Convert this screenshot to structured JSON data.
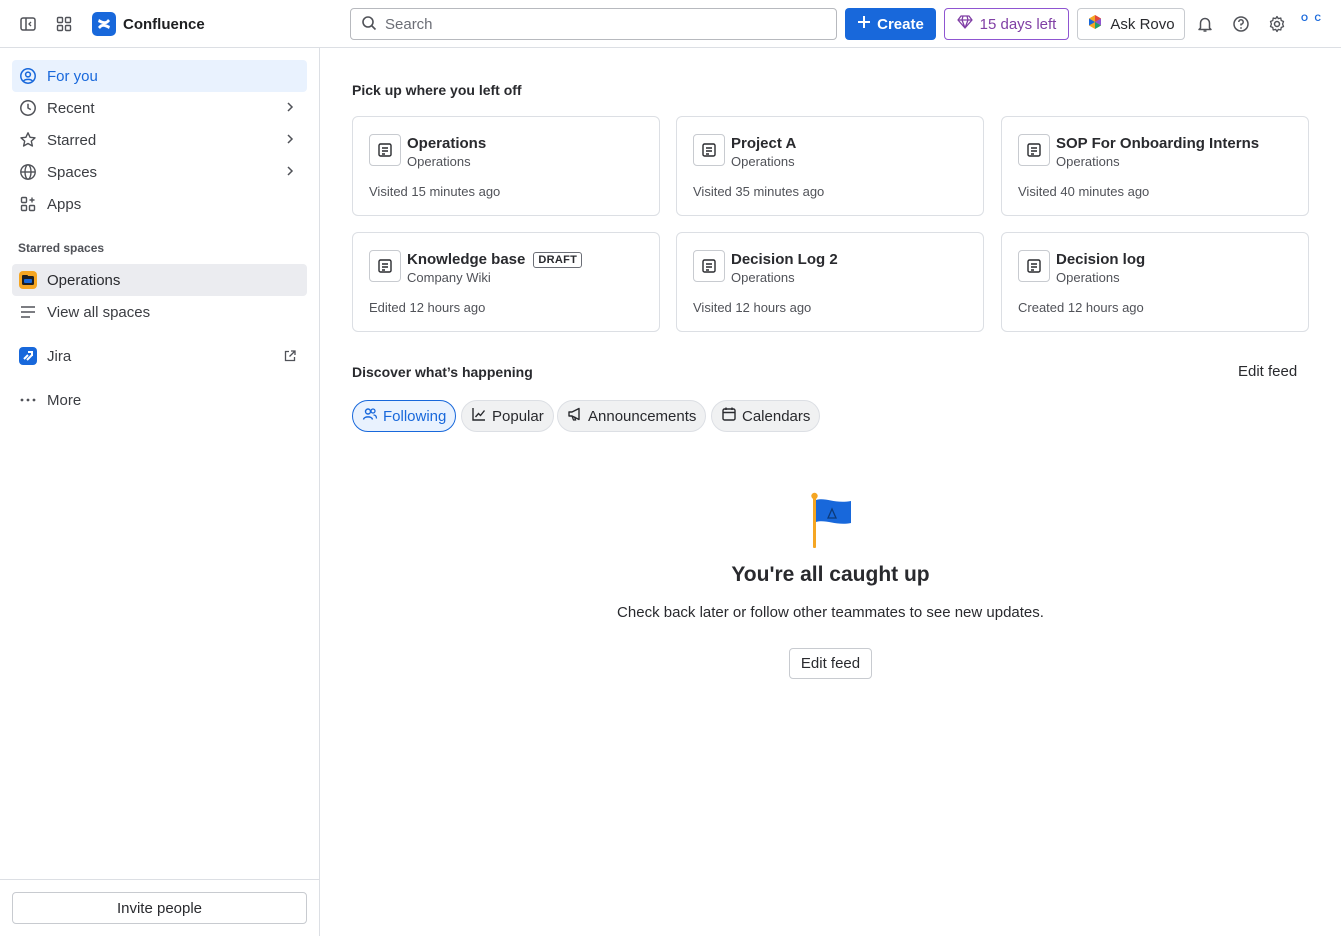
{
  "topbar": {
    "app_name": "Confluence",
    "search_placeholder": "Search",
    "create_label": "Create",
    "trial_label": "15 days left",
    "rovo_label": "Ask Rovo",
    "avatar_initials": "O C",
    "brand_color": "#1868db"
  },
  "sidebar": {
    "items": [
      {
        "label": "For you"
      },
      {
        "label": "Recent"
      },
      {
        "label": "Starred"
      },
      {
        "label": "Spaces"
      },
      {
        "label": "Apps"
      }
    ],
    "starred_heading": "Starred spaces",
    "starred_space": "Operations",
    "view_all": "View all spaces",
    "jira": "Jira",
    "more": "More",
    "invite": "Invite people"
  },
  "main": {
    "recent_title": "Pick up where you left off",
    "cards": [
      {
        "title": "Operations",
        "space": "Operations",
        "meta": "Visited 15 minutes ago"
      },
      {
        "title": "Project A",
        "space": "Operations",
        "meta": "Visited 35 minutes ago"
      },
      {
        "title": "SOP For Onboarding Interns",
        "space": "Operations",
        "meta": "Visited 40 minutes ago"
      },
      {
        "title": "Knowledge base",
        "badge": "DRAFT",
        "space": "Company Wiki",
        "meta": "Edited 12 hours ago"
      },
      {
        "title": "Decision Log 2",
        "space": "Operations",
        "meta": "Visited 12 hours ago"
      },
      {
        "title": "Decision log",
        "space": "Operations",
        "meta": "Created 12 hours ago"
      }
    ],
    "discover_title": "Discover what’s happening",
    "edit_feed_link": "Edit feed",
    "tabs": [
      {
        "label": "Following"
      },
      {
        "label": "Popular"
      },
      {
        "label": "Announcements"
      },
      {
        "label": "Calendars"
      }
    ],
    "empty_title": "You're all caught up",
    "empty_text": "Check back later or follow other teammates to see new updates.",
    "edit_feed_button": "Edit feed"
  }
}
